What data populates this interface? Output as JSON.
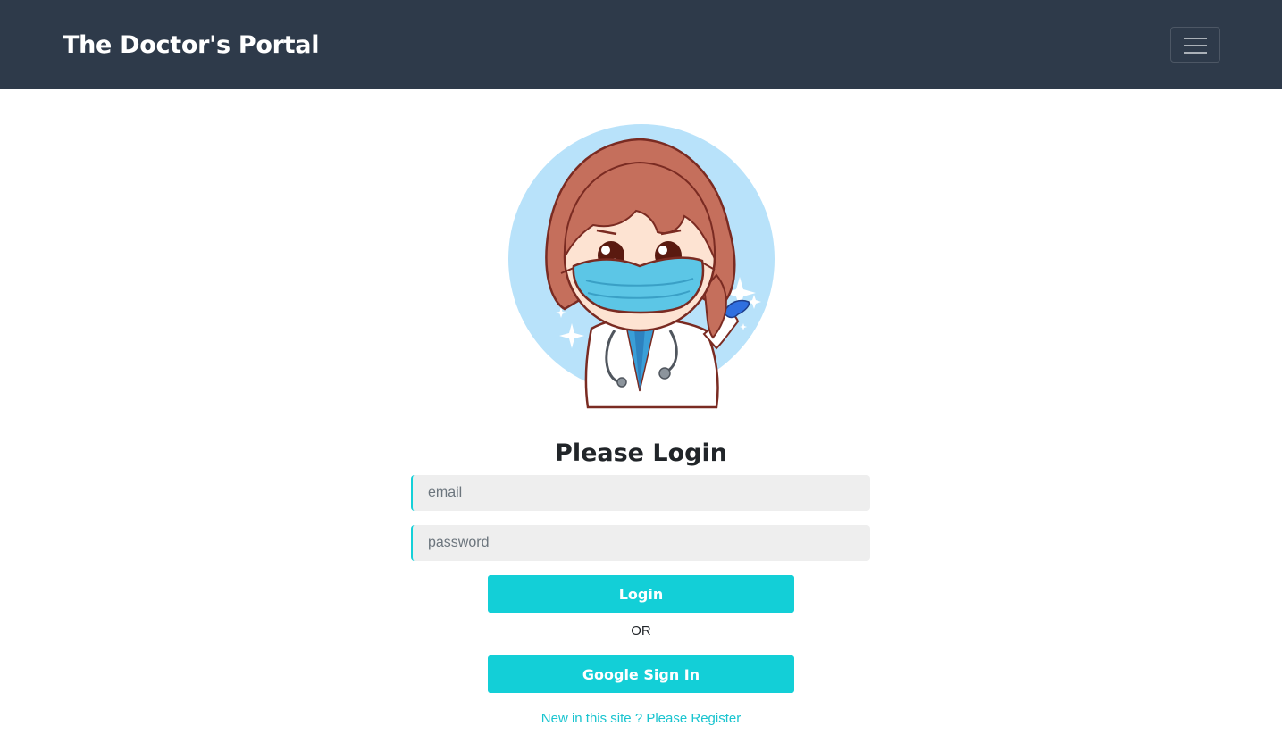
{
  "navbar": {
    "brand": "The Doctor's Portal",
    "toggler_icon": "hamburger-menu-icon"
  },
  "illustration": {
    "icon": "doctor-illustration"
  },
  "login": {
    "heading": "Please Login",
    "email_placeholder": "email",
    "password_placeholder": "password",
    "login_label": "Login",
    "or_label": "OR",
    "google_label": "Google Sign In",
    "register_link": "New in this site ? Please Register"
  },
  "colors": {
    "navbar_bg": "#2e3a4a",
    "accent": "#13cfd7",
    "input_bg": "#eeeeee",
    "link": "#19c4cf"
  }
}
